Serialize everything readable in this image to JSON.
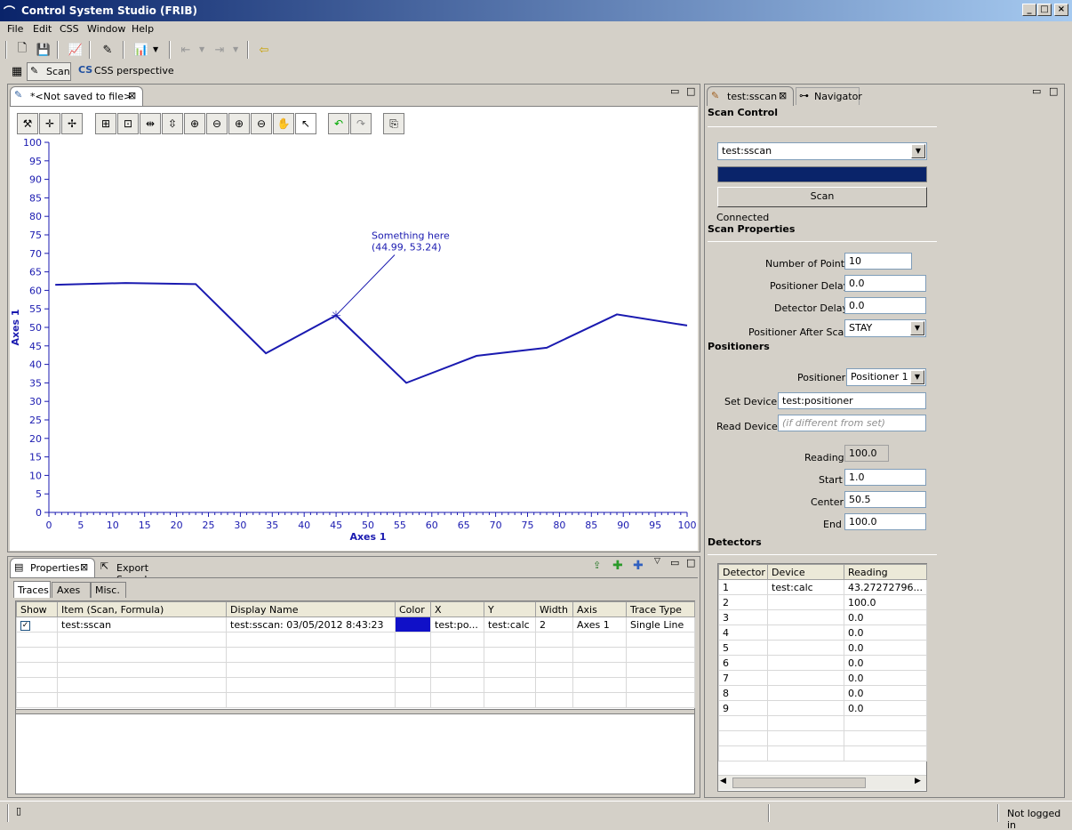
{
  "window": {
    "title": "Control System Studio (FRIB)"
  },
  "menu": [
    "File",
    "Edit",
    "CSS",
    "Window",
    "Help"
  ],
  "perspectives": {
    "scan": "Scan",
    "css": "CSS perspective"
  },
  "editor": {
    "tab": "*<Not saved to file>"
  },
  "chart_data": {
    "type": "line",
    "xlabel": "Axes 1",
    "ylabel": "Axes 1",
    "xlim": [
      0,
      100
    ],
    "ylim": [
      0,
      100
    ],
    "xticks": [
      0,
      5,
      10,
      15,
      20,
      25,
      30,
      35,
      40,
      45,
      50,
      55,
      60,
      65,
      70,
      75,
      80,
      85,
      90,
      95,
      100
    ],
    "yticks": [
      0,
      5,
      10,
      15,
      20,
      25,
      30,
      35,
      40,
      45,
      50,
      55,
      60,
      65,
      70,
      75,
      80,
      85,
      90,
      95,
      100
    ],
    "series": [
      {
        "color": "#1a1ab0",
        "x": [
          1,
          12,
          23,
          34,
          45,
          56,
          67,
          78,
          89,
          100
        ],
        "y": [
          61.5,
          62,
          61.7,
          43,
          53.24,
          35,
          42.3,
          44.5,
          53.5,
          50.5
        ]
      }
    ],
    "annotation": {
      "text": "Something here",
      "coords": "(44.99, 53.24)",
      "x": 44.99,
      "y": 53.24
    }
  },
  "bottom": {
    "tabs": [
      "Properties",
      "Export Samples"
    ],
    "subtabs": [
      "Traces",
      "Axes",
      "Misc."
    ],
    "columns": [
      "Show",
      "Item (Scan, Formula)",
      "Display Name",
      "Color",
      "X",
      "Y",
      "Width",
      "Axis",
      "Trace Type"
    ],
    "row": {
      "item": "test:sscan",
      "display": "test:sscan: 03/05/2012 8:43:23",
      "x": "test:po...",
      "y": "test:calc",
      "width": "2",
      "axis": "Axes 1",
      "type": "Single Line",
      "color": "#1010c8"
    }
  },
  "right": {
    "tabs": [
      "test:sscan",
      "Navigator"
    ],
    "scan_control": "Scan Control",
    "scan_combo": "test:sscan",
    "scan_button": "Scan",
    "status": "Connected",
    "scan_properties": "Scan Properties",
    "num_points_label": "Number of Points",
    "num_points": "10",
    "pos_delay_label": "Positioner Delay",
    "pos_delay": "0.0",
    "det_delay_label": "Detector Delay",
    "det_delay": "0.0",
    "after_scan_label": "Positioner After Scan",
    "after_scan": "STAY",
    "positioners": "Positioners",
    "positioner_label": "Positioner",
    "positioner": "Positioner 1",
    "set_device_label": "Set Device",
    "set_device": "test:positioner",
    "read_device_label": "Read Device",
    "read_device_placeholder": "(if different from set)",
    "reading_label": "Reading",
    "reading": "100.0",
    "start_label": "Start",
    "start": "1.0",
    "center_label": "Center",
    "center": "50.5",
    "end_label": "End",
    "end": "100.0",
    "detectors": "Detectors",
    "det_columns": [
      "Detector",
      "Device",
      "Reading"
    ],
    "det_rows": [
      [
        "1",
        "test:calc",
        "43.27272796..."
      ],
      [
        "2",
        "",
        "100.0"
      ],
      [
        "3",
        "",
        "0.0"
      ],
      [
        "4",
        "",
        "0.0"
      ],
      [
        "5",
        "",
        "0.0"
      ],
      [
        "6",
        "",
        "0.0"
      ],
      [
        "7",
        "",
        "0.0"
      ],
      [
        "8",
        "",
        "0.0"
      ],
      [
        "9",
        "",
        "0.0"
      ]
    ]
  },
  "statusbar": {
    "login": "Not logged in"
  }
}
